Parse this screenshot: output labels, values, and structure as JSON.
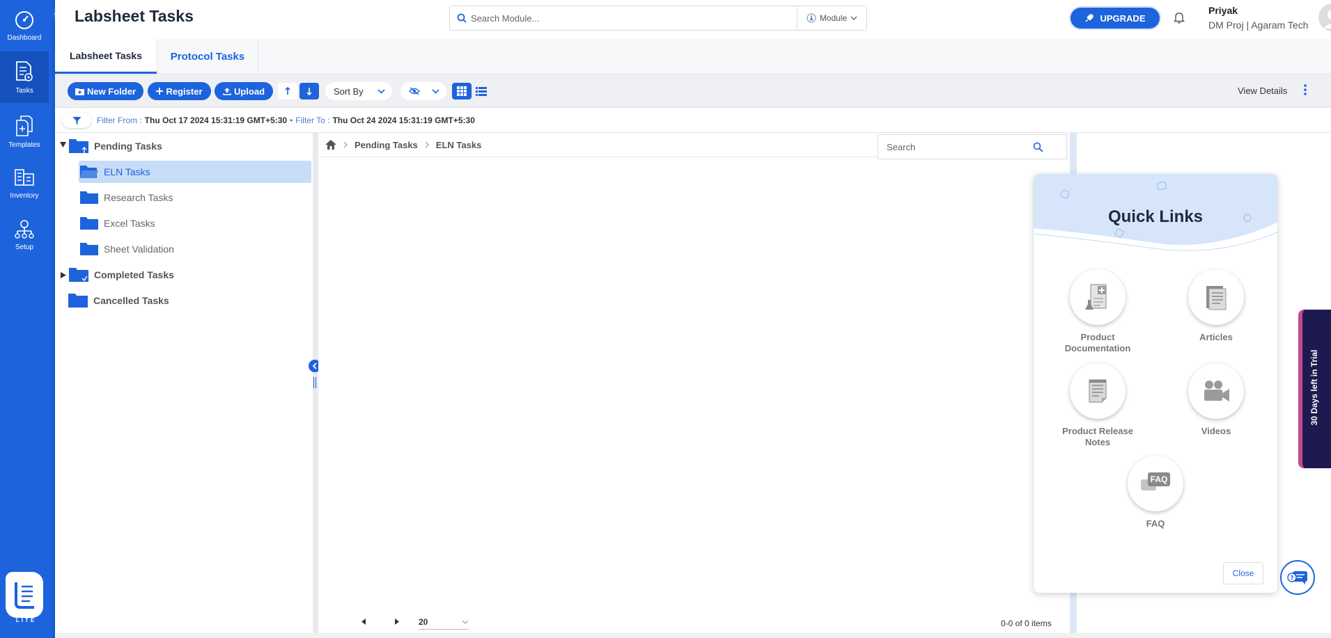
{
  "rail": {
    "items": [
      {
        "label": "Dashboard",
        "icon": "dashboard-gauge-icon"
      },
      {
        "label": "Tasks",
        "icon": "tasks-document-icon"
      },
      {
        "label": "Templates",
        "icon": "templates-icon"
      },
      {
        "label": "Inventory",
        "icon": "inventory-icon"
      },
      {
        "label": "Setup",
        "icon": "setup-icon"
      }
    ],
    "active": "Tasks",
    "logo_text": "LITE"
  },
  "header": {
    "title": "Labsheet Tasks",
    "search_placeholder": "Search Module...",
    "module_label": "Module",
    "upgrade_label": "UPGRADE",
    "user_name": "Priyak",
    "user_org": "DM Proj | Agaram Tech"
  },
  "tabs": [
    {
      "label": "Labsheet Tasks",
      "active": true
    },
    {
      "label": "Protocol Tasks",
      "active": false
    }
  ],
  "toolbar": {
    "new_folder": "New Folder",
    "register": "Register",
    "upload": "Upload",
    "sort_by": "Sort By",
    "view_details": "View Details"
  },
  "filter": {
    "from_label": "Filter From :",
    "from_value": "Thu Oct 17 2024 15:31:19 GMT+5:30",
    "separator": "•",
    "to_label": "Filter To :",
    "to_value": "Thu Oct 24 2024 15:31:19 GMT+5:30"
  },
  "tree": {
    "pending": "Pending Tasks",
    "children": [
      "ELN Tasks",
      "Research Tasks",
      "Excel Tasks",
      "Sheet Validation"
    ],
    "selected": "ELN Tasks",
    "completed": "Completed Tasks",
    "cancelled": "Cancelled Tasks"
  },
  "breadcrumb": {
    "items": [
      "Pending Tasks",
      "ELN Tasks"
    ]
  },
  "main_search": {
    "placeholder": "Search"
  },
  "pager": {
    "page_size": "20",
    "info": "0-0 of 0 items"
  },
  "quick_links": {
    "title": "Quick Links",
    "items": [
      {
        "label": "Product Documentation",
        "icon": "product-documentation-icon"
      },
      {
        "label": "Articles",
        "icon": "articles-icon"
      },
      {
        "label": "Product Release Notes",
        "icon": "release-notes-icon"
      },
      {
        "label": "Videos",
        "icon": "videos-icon"
      },
      {
        "label": "FAQ",
        "icon": "faq-icon"
      }
    ],
    "faq_badge": "FAQ",
    "close_label": "Close"
  },
  "trial": {
    "label": "30 Days left in Trial"
  },
  "colors": {
    "primary": "#1d63dc",
    "rail": "#1d63dc",
    "selected_row": "#c7dcf7",
    "trial_bg": "#1d1a4f",
    "trial_accent": "#c24a8d"
  }
}
